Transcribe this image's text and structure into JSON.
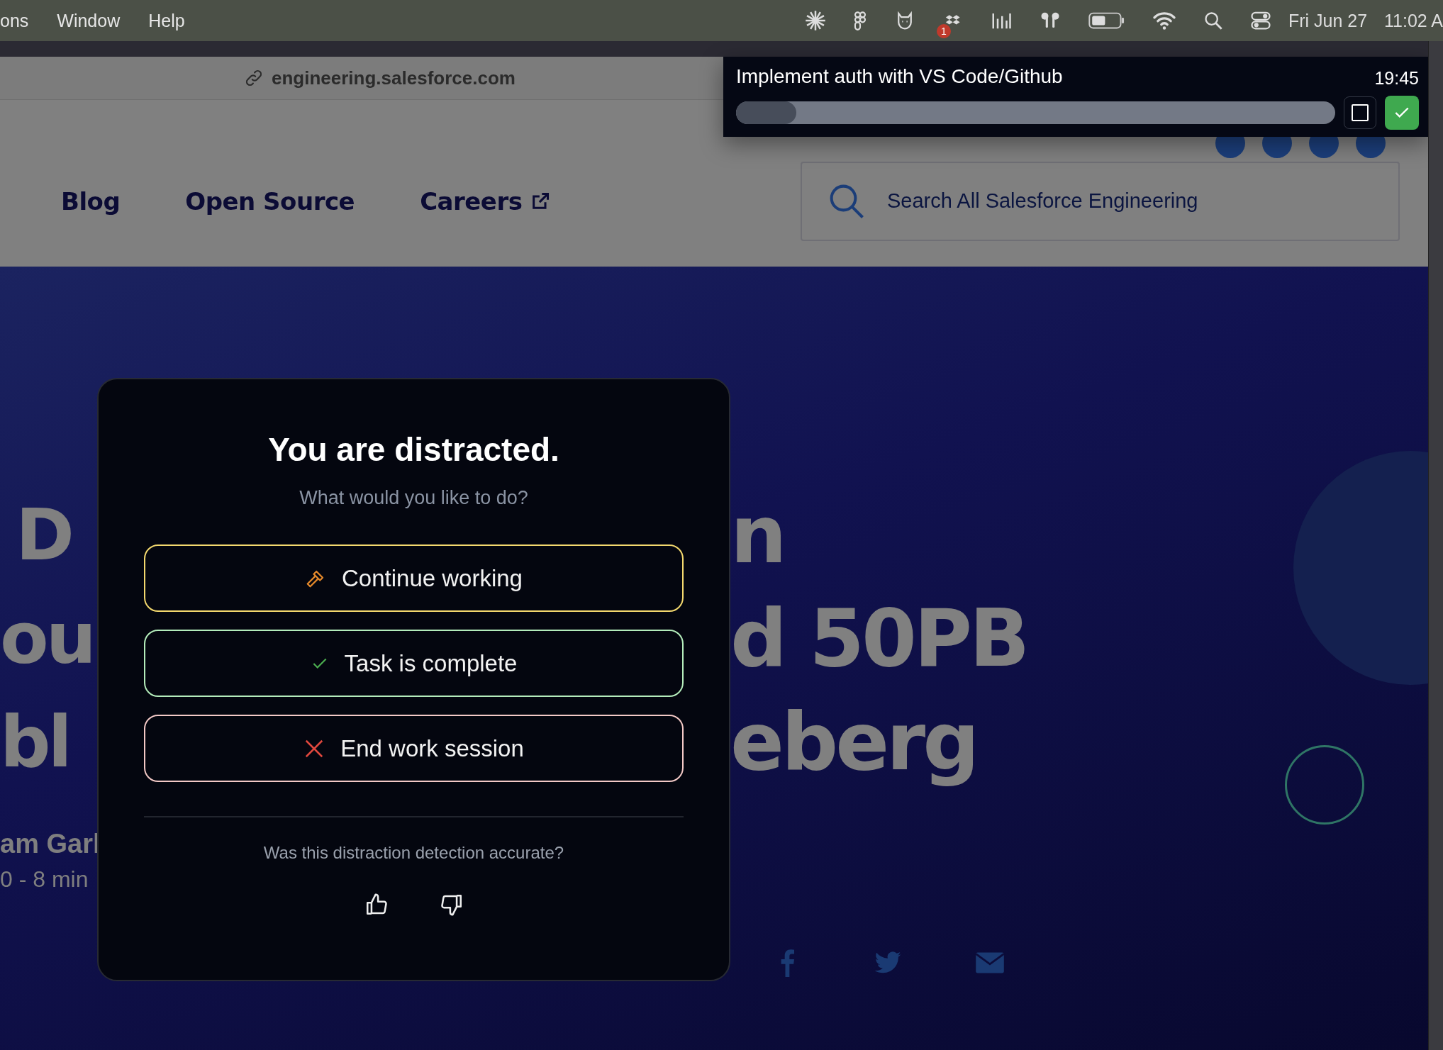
{
  "menu_bar": {
    "menus": [
      "ons",
      "Window",
      "Help"
    ],
    "notification_count": "1",
    "date": "Fri Jun 27",
    "time": "11:02 A"
  },
  "browser": {
    "url": "engineering.salesforce.com"
  },
  "site_nav": {
    "links": [
      {
        "label": "Blog",
        "external": false
      },
      {
        "label": "Open Source",
        "external": false
      },
      {
        "label": "Careers",
        "external": true
      }
    ],
    "search": {
      "placeholder": "Search All Salesforce Engineering"
    }
  },
  "hero": {
    "lines": [
      {
        "left": "D",
        "right": "n"
      },
      {
        "left": "ou",
        "right": "d 50PB"
      },
      {
        "left": "bl",
        "right": "eberg"
      }
    ],
    "author": "am Garl",
    "meta": "0 - 8 min"
  },
  "task_widget": {
    "title": "Implement auth with VS Code/Github",
    "timer": "19:45",
    "level": 0.1
  },
  "dialog": {
    "title": "You are distracted.",
    "subtitle": "What would you like to do?",
    "actions": [
      {
        "kind": "continue",
        "label": "Continue working"
      },
      {
        "kind": "complete",
        "label": "Task is complete"
      },
      {
        "kind": "end",
        "label": "End work session"
      }
    ],
    "feedback_question": "Was this distraction detection accurate?"
  }
}
